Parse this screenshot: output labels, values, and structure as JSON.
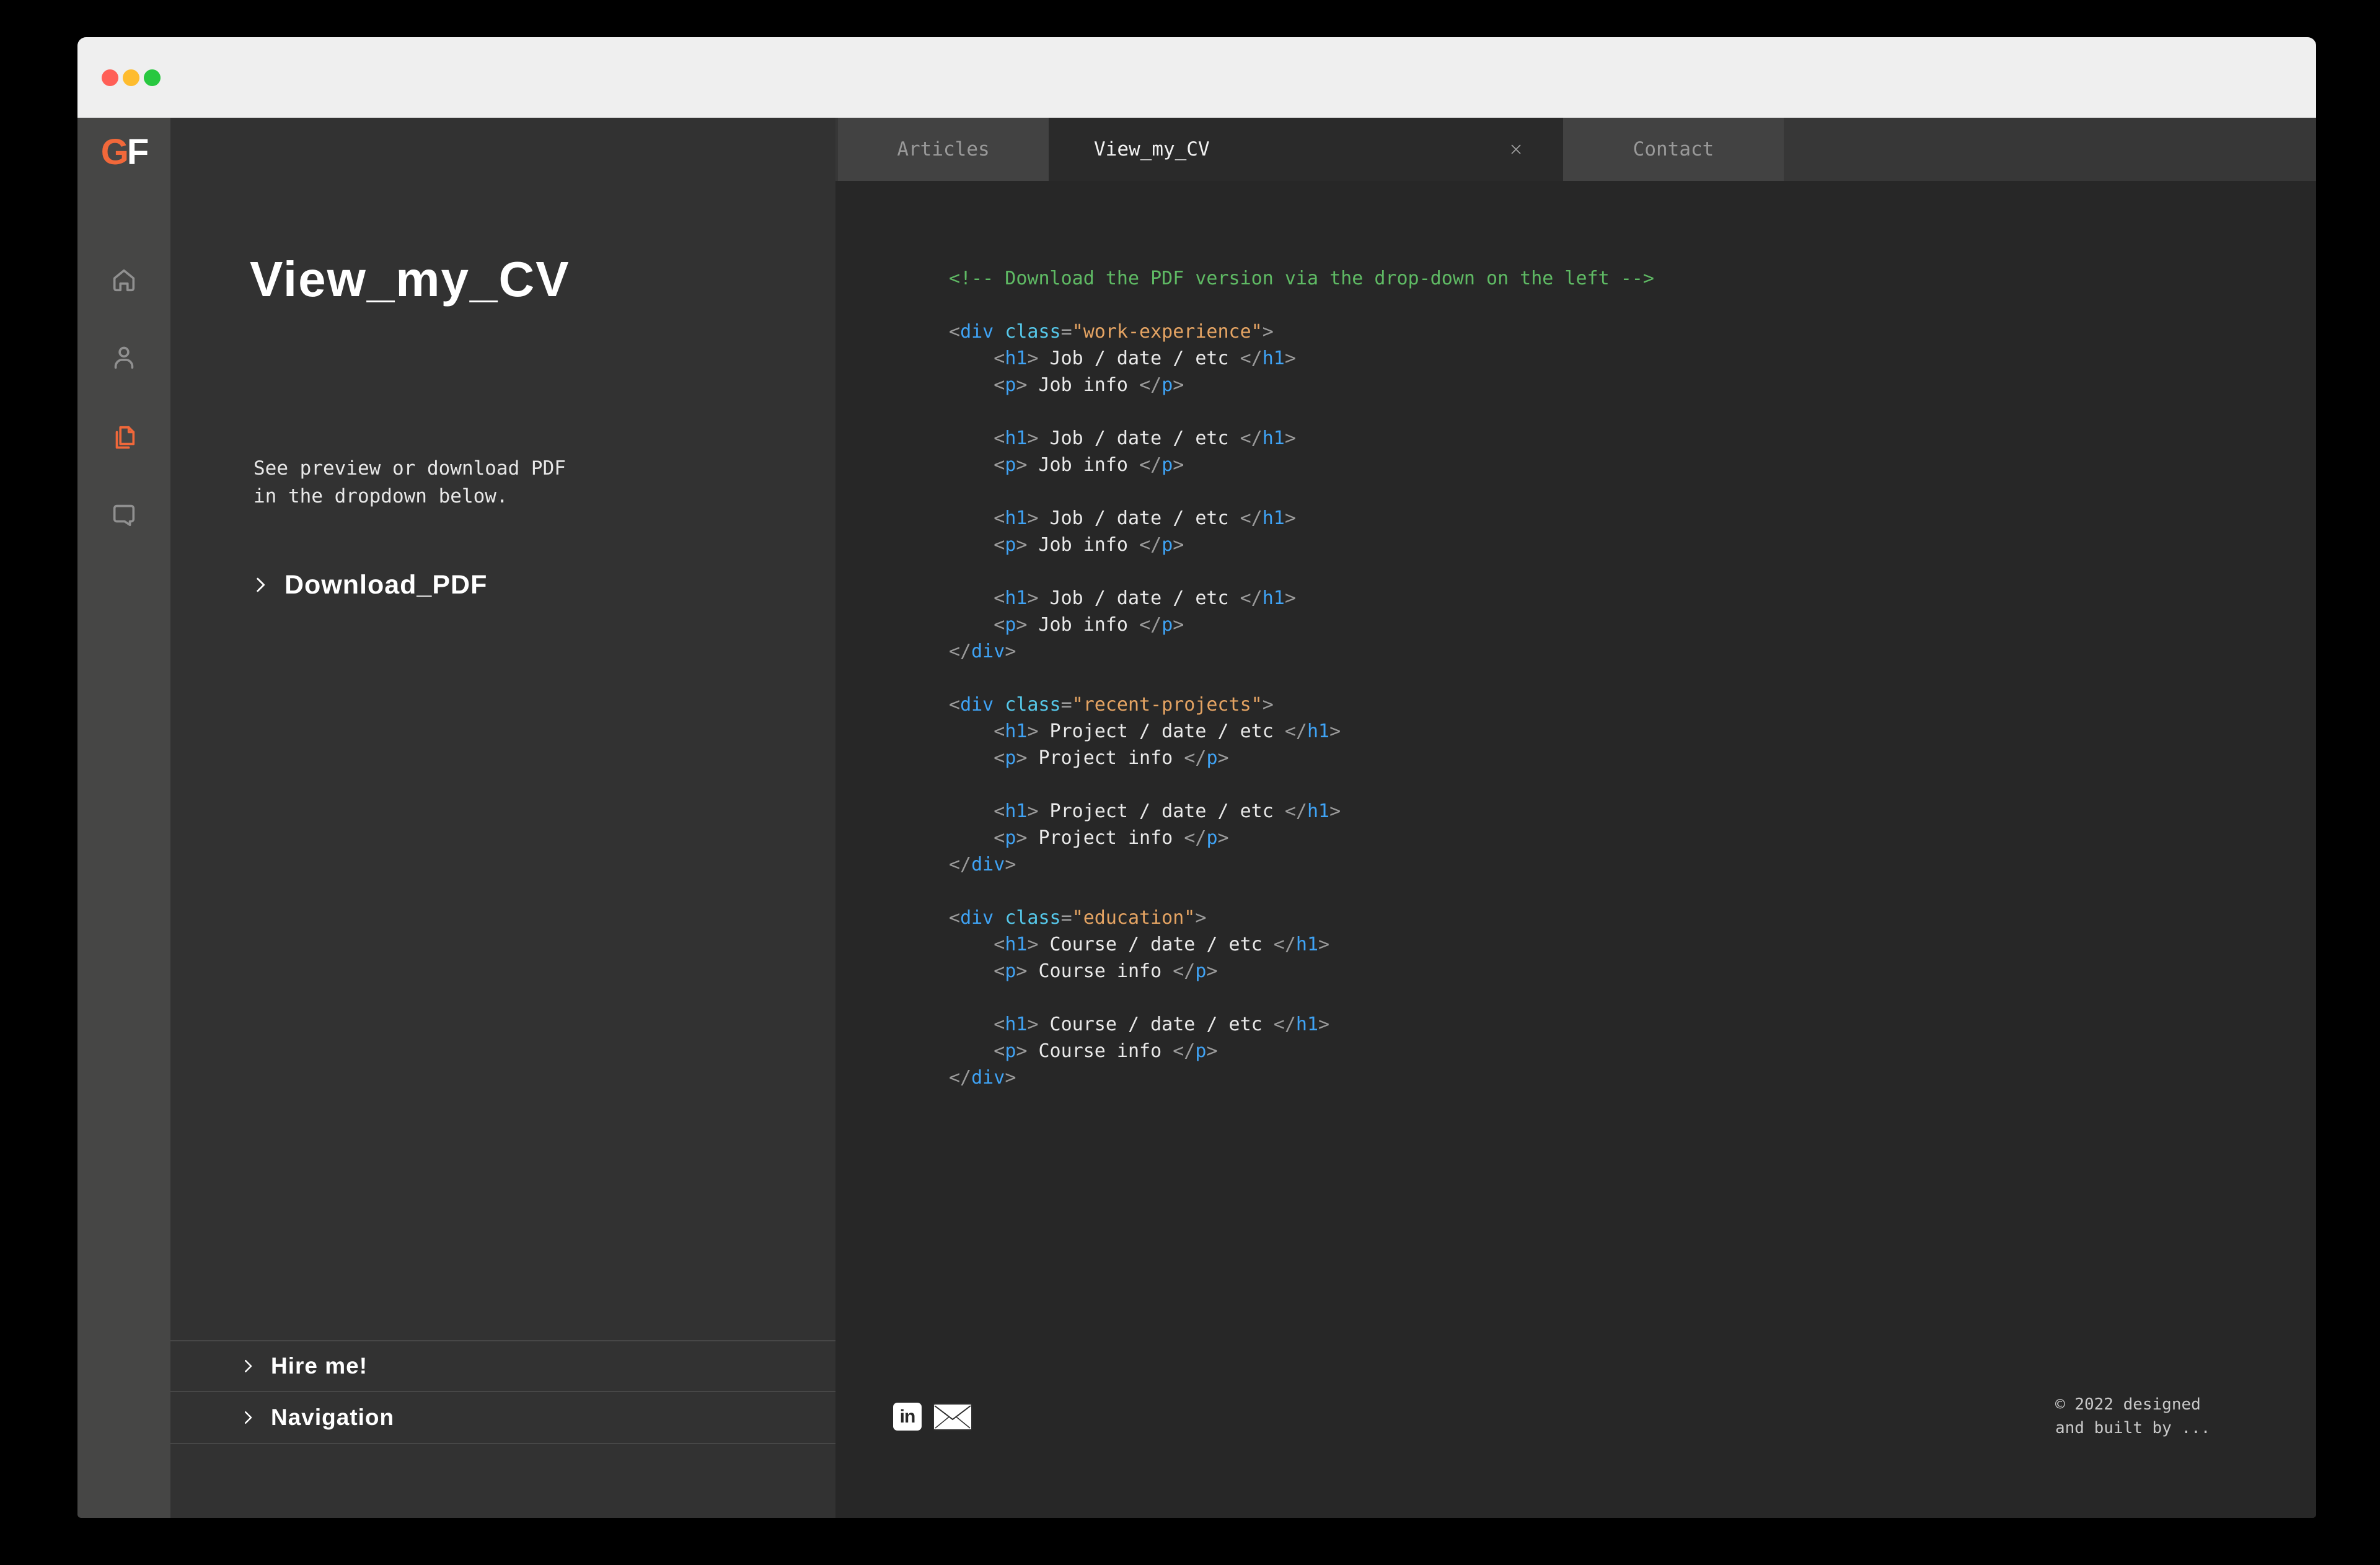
{
  "colors": {
    "accent_orange": "#f1683a",
    "traffic_red": "#ff5f57",
    "traffic_yellow": "#febc2e",
    "traffic_green": "#28c840",
    "code_comment_green": "#5fba64",
    "code_tag_blue": "#3fa3f5",
    "code_attr_cyan": "#56c8ea",
    "code_string_orange": "#e5a463"
  },
  "logo": {
    "g": "G",
    "f": "F"
  },
  "rail": {
    "items": [
      {
        "icon": "home-icon",
        "active": false
      },
      {
        "icon": "person-icon",
        "active": false
      },
      {
        "icon": "documents-icon",
        "active": true
      },
      {
        "icon": "chat-icon",
        "active": false
      }
    ]
  },
  "panel": {
    "title": "View_my_CV",
    "description_line1": "See preview or download PDF",
    "description_line2": "in the dropdown below.",
    "download": {
      "label": "Download_PDF"
    },
    "footer_items": [
      {
        "label": "Hire me!"
      },
      {
        "label": "Navigation"
      }
    ]
  },
  "tabs": {
    "items": [
      {
        "label": "Articles",
        "active": false
      },
      {
        "label": "View_my_CV",
        "active": true,
        "closable": true
      },
      {
        "label": "Contact",
        "active": false
      }
    ]
  },
  "code": {
    "lines": [
      [
        [
          "c",
          "<!-- Download the PDF version via the drop-down on the left -->"
        ]
      ],
      [],
      [
        [
          "g",
          "<"
        ],
        [
          "t",
          "div"
        ],
        [
          "w",
          " "
        ],
        [
          "a",
          "class"
        ],
        [
          "g",
          "="
        ],
        [
          "s",
          "\"work-experience\""
        ],
        [
          "g",
          ">"
        ]
      ],
      [
        [
          "g",
          "    <"
        ],
        [
          "t",
          "h1"
        ],
        [
          "g",
          ">"
        ],
        [
          "w",
          " Job / date / etc "
        ],
        [
          "g",
          "</"
        ],
        [
          "t",
          "h1"
        ],
        [
          "g",
          ">"
        ]
      ],
      [
        [
          "g",
          "    <"
        ],
        [
          "t",
          "p"
        ],
        [
          "g",
          ">"
        ],
        [
          "w",
          " Job info "
        ],
        [
          "g",
          "</"
        ],
        [
          "t",
          "p"
        ],
        [
          "g",
          ">"
        ]
      ],
      [],
      [
        [
          "g",
          "    <"
        ],
        [
          "t",
          "h1"
        ],
        [
          "g",
          ">"
        ],
        [
          "w",
          " Job / date / etc "
        ],
        [
          "g",
          "</"
        ],
        [
          "t",
          "h1"
        ],
        [
          "g",
          ">"
        ]
      ],
      [
        [
          "g",
          "    <"
        ],
        [
          "t",
          "p"
        ],
        [
          "g",
          ">"
        ],
        [
          "w",
          " Job info "
        ],
        [
          "g",
          "</"
        ],
        [
          "t",
          "p"
        ],
        [
          "g",
          ">"
        ]
      ],
      [],
      [
        [
          "g",
          "    <"
        ],
        [
          "t",
          "h1"
        ],
        [
          "g",
          ">"
        ],
        [
          "w",
          " Job / date / etc "
        ],
        [
          "g",
          "</"
        ],
        [
          "t",
          "h1"
        ],
        [
          "g",
          ">"
        ]
      ],
      [
        [
          "g",
          "    <"
        ],
        [
          "t",
          "p"
        ],
        [
          "g",
          ">"
        ],
        [
          "w",
          " Job info "
        ],
        [
          "g",
          "</"
        ],
        [
          "t",
          "p"
        ],
        [
          "g",
          ">"
        ]
      ],
      [],
      [
        [
          "g",
          "    <"
        ],
        [
          "t",
          "h1"
        ],
        [
          "g",
          ">"
        ],
        [
          "w",
          " Job / date / etc "
        ],
        [
          "g",
          "</"
        ],
        [
          "t",
          "h1"
        ],
        [
          "g",
          ">"
        ]
      ],
      [
        [
          "g",
          "    <"
        ],
        [
          "t",
          "p"
        ],
        [
          "g",
          ">"
        ],
        [
          "w",
          " Job info "
        ],
        [
          "g",
          "</"
        ],
        [
          "t",
          "p"
        ],
        [
          "g",
          ">"
        ]
      ],
      [
        [
          "g",
          "</"
        ],
        [
          "t",
          "div"
        ],
        [
          "g",
          ">"
        ]
      ],
      [],
      [
        [
          "g",
          "<"
        ],
        [
          "t",
          "div"
        ],
        [
          "w",
          " "
        ],
        [
          "a",
          "class"
        ],
        [
          "g",
          "="
        ],
        [
          "s",
          "\"recent-projects\""
        ],
        [
          "g",
          ">"
        ]
      ],
      [
        [
          "g",
          "    <"
        ],
        [
          "t",
          "h1"
        ],
        [
          "g",
          ">"
        ],
        [
          "w",
          " Project / date / etc "
        ],
        [
          "g",
          "</"
        ],
        [
          "t",
          "h1"
        ],
        [
          "g",
          ">"
        ]
      ],
      [
        [
          "g",
          "    <"
        ],
        [
          "t",
          "p"
        ],
        [
          "g",
          ">"
        ],
        [
          "w",
          " Project info "
        ],
        [
          "g",
          "</"
        ],
        [
          "t",
          "p"
        ],
        [
          "g",
          ">"
        ]
      ],
      [],
      [
        [
          "g",
          "    <"
        ],
        [
          "t",
          "h1"
        ],
        [
          "g",
          ">"
        ],
        [
          "w",
          " Project / date / etc "
        ],
        [
          "g",
          "</"
        ],
        [
          "t",
          "h1"
        ],
        [
          "g",
          ">"
        ]
      ],
      [
        [
          "g",
          "    <"
        ],
        [
          "t",
          "p"
        ],
        [
          "g",
          ">"
        ],
        [
          "w",
          " Project info "
        ],
        [
          "g",
          "</"
        ],
        [
          "t",
          "p"
        ],
        [
          "g",
          ">"
        ]
      ],
      [
        [
          "g",
          "</"
        ],
        [
          "t",
          "div"
        ],
        [
          "g",
          ">"
        ]
      ],
      [],
      [
        [
          "g",
          "<"
        ],
        [
          "t",
          "div"
        ],
        [
          "w",
          " "
        ],
        [
          "a",
          "class"
        ],
        [
          "g",
          "="
        ],
        [
          "s",
          "\"education\""
        ],
        [
          "g",
          ">"
        ]
      ],
      [
        [
          "g",
          "    <"
        ],
        [
          "t",
          "h1"
        ],
        [
          "g",
          ">"
        ],
        [
          "w",
          " Course / date / etc "
        ],
        [
          "g",
          "</"
        ],
        [
          "t",
          "h1"
        ],
        [
          "g",
          ">"
        ]
      ],
      [
        [
          "g",
          "    <"
        ],
        [
          "t",
          "p"
        ],
        [
          "g",
          ">"
        ],
        [
          "w",
          " Course info "
        ],
        [
          "g",
          "</"
        ],
        [
          "t",
          "p"
        ],
        [
          "g",
          ">"
        ]
      ],
      [],
      [
        [
          "g",
          "    <"
        ],
        [
          "t",
          "h1"
        ],
        [
          "g",
          ">"
        ],
        [
          "w",
          " Course / date / etc "
        ],
        [
          "g",
          "</"
        ],
        [
          "t",
          "h1"
        ],
        [
          "g",
          ">"
        ]
      ],
      [
        [
          "g",
          "    <"
        ],
        [
          "t",
          "p"
        ],
        [
          "g",
          ">"
        ],
        [
          "w",
          " Course info "
        ],
        [
          "g",
          "</"
        ],
        [
          "t",
          "p"
        ],
        [
          "g",
          ">"
        ]
      ],
      [
        [
          "g",
          "</"
        ],
        [
          "t",
          "div"
        ],
        [
          "g",
          ">"
        ]
      ]
    ]
  },
  "footer": {
    "linkedin_label": "in",
    "copyright_line1": "© 2022 designed",
    "copyright_line2": "and built by ..."
  }
}
